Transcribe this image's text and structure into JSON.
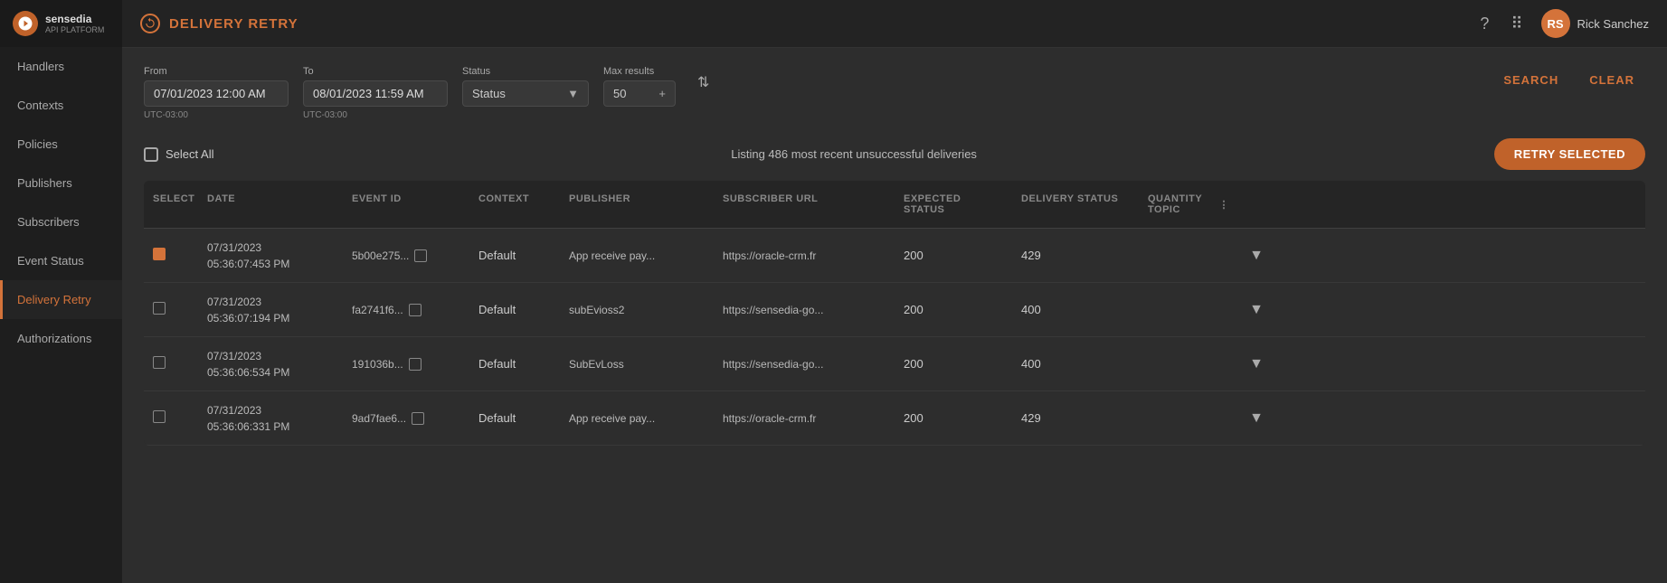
{
  "sidebar": {
    "logo": {
      "icon_text": "S",
      "brand": "sensedia",
      "sub": "API PLATFORM"
    },
    "items": [
      {
        "label": "Handlers",
        "key": "handlers",
        "active": false
      },
      {
        "label": "Contexts",
        "key": "contexts",
        "active": false
      },
      {
        "label": "Policies",
        "key": "policies",
        "active": false
      },
      {
        "label": "Publishers",
        "key": "publishers",
        "active": false
      },
      {
        "label": "Subscribers",
        "key": "subscribers",
        "active": false
      },
      {
        "label": "Event Status",
        "key": "event-status",
        "active": false
      },
      {
        "label": "Delivery Retry",
        "key": "delivery-retry",
        "active": true
      },
      {
        "label": "Authorizations",
        "key": "authorizations",
        "active": false
      }
    ]
  },
  "topbar": {
    "title": "DELIVERY RETRY",
    "user_name": "Rick Sanchez",
    "user_initials": "RS"
  },
  "filters": {
    "from_label": "From",
    "from_value": "07/01/2023 12:00 AM",
    "from_tz": "UTC-03:00",
    "to_label": "To",
    "to_value": "08/01/2023 11:59 AM",
    "to_tz": "UTC-03:00",
    "status_label": "Status",
    "status_value": "Status",
    "max_label": "Max results",
    "max_value": "50",
    "search_btn": "SEARCH",
    "clear_btn": "CLEAR"
  },
  "table": {
    "select_all_label": "Select All",
    "listing_info": "Listing 486 most recent unsuccessful deliveries",
    "retry_btn": "RETRY SELECTED",
    "columns": [
      {
        "key": "select",
        "label": "SELECT"
      },
      {
        "key": "date",
        "label": "DATE"
      },
      {
        "key": "event_id",
        "label": "EVENT ID"
      },
      {
        "key": "context",
        "label": "CONTEXT"
      },
      {
        "key": "publisher",
        "label": "PUBLISHER"
      },
      {
        "key": "subscriber_url",
        "label": "SUBSCRIBER URL"
      },
      {
        "key": "expected_status",
        "label": "EXPECTED STATUS"
      },
      {
        "key": "delivery_status",
        "label": "DELIVERY STATUS"
      },
      {
        "key": "quantity_topic",
        "label": "QUANTITY TOPIC"
      },
      {
        "key": "expand",
        "label": ""
      }
    ],
    "rows": [
      {
        "checked": true,
        "date_line1": "07/31/2023",
        "date_line2": "05:36:07:453 PM",
        "event_id": "5b00e275...",
        "context": "Default",
        "publisher": "App receive pay...",
        "subscriber_url": "https://oracle-crm.fr",
        "expected_status": "200",
        "delivery_status": "429",
        "quantity_topic": "",
        "expanded": false
      },
      {
        "checked": false,
        "date_line1": "07/31/2023",
        "date_line2": "05:36:07:194 PM",
        "event_id": "fa2741f6...",
        "context": "Default",
        "publisher": "subEvioss2",
        "subscriber_url": "https://sensedia-go...",
        "expected_status": "200",
        "delivery_status": "400",
        "quantity_topic": "",
        "expanded": false
      },
      {
        "checked": false,
        "date_line1": "07/31/2023",
        "date_line2": "05:36:06:534 PM",
        "event_id": "191036b...",
        "context": "Default",
        "publisher": "SubEvLoss",
        "subscriber_url": "https://sensedia-go...",
        "expected_status": "200",
        "delivery_status": "400",
        "quantity_topic": "",
        "expanded": false
      },
      {
        "checked": false,
        "date_line1": "07/31/2023",
        "date_line2": "05:36:06:331 PM",
        "event_id": "9ad7fae6...",
        "context": "Default",
        "publisher": "App receive pay...",
        "subscriber_url": "https://oracle-crm.fr",
        "expected_status": "200",
        "delivery_status": "429",
        "quantity_topic": "",
        "expanded": false
      }
    ]
  }
}
